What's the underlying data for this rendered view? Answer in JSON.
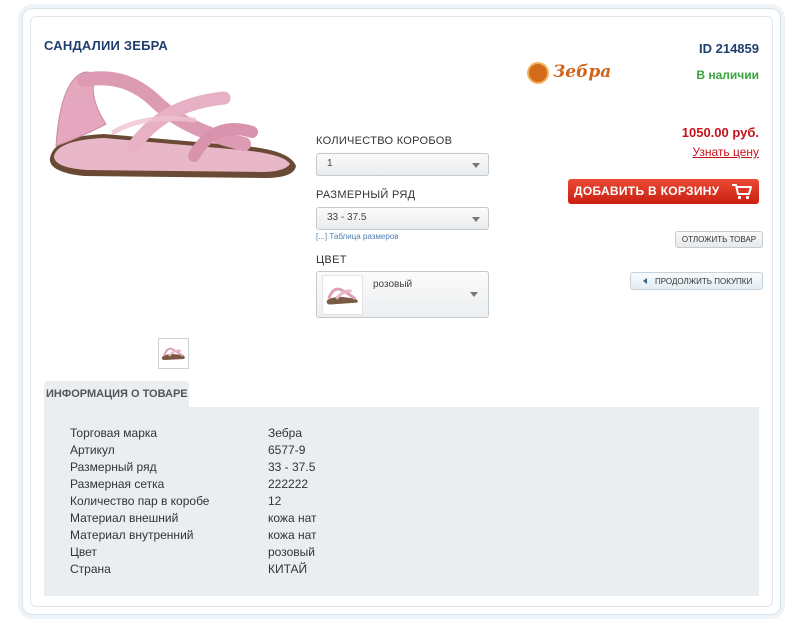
{
  "product": {
    "title": "САНДАЛИИ ЗЕБРА",
    "id": "ID 214859",
    "stock": "В наличии",
    "brand_logo_text": "Зебра",
    "price": "1050.00 руб.",
    "ask_price": "Узнать цену"
  },
  "options": {
    "boxes_label": "КОЛИЧЕСТВО КОРОБОВ",
    "boxes_value": "1",
    "size_label": "РАЗМЕРНЫЙ РЯД",
    "size_value": "33 - 37.5",
    "size_table_link": "[...] Таблица размеров",
    "color_label": "ЦВЕТ",
    "color_value": "розовый"
  },
  "actions": {
    "add_to_cart": "ДОБАВИТЬ В КОРЗИНУ",
    "defer": "ОТЛОЖИТЬ ТОВАР",
    "continue": "ПРОДОЛЖИТЬ ПОКУПКИ"
  },
  "info": {
    "tab": "ИНФОРМАЦИЯ О ТОВАРЕ",
    "rows": [
      {
        "k": "Торговая марка",
        "v": "Зебра"
      },
      {
        "k": "Артикул",
        "v": "6577-9"
      },
      {
        "k": "Размерный ряд",
        "v": "33 - 37.5"
      },
      {
        "k": "Размерная сетка",
        "v": "222222"
      },
      {
        "k": "Количество пар в коробе",
        "v": "12"
      },
      {
        "k": "Материал внешний",
        "v": "кожа нат"
      },
      {
        "k": "Материал внутренний",
        "v": "кожа нат"
      },
      {
        "k": "Цвет",
        "v": "розовый"
      },
      {
        "k": "Страна",
        "v": "КИТАЙ"
      }
    ]
  },
  "colors": {
    "accent_blue": "#1f3f6e",
    "stock_green": "#3aa53c",
    "price_red": "#c5121a",
    "cart_red": "#d9301f"
  },
  "icons": {
    "cart": "shopping-cart-icon",
    "continue": "triangle-left-icon",
    "dropdown": "chevron-down-icon"
  }
}
